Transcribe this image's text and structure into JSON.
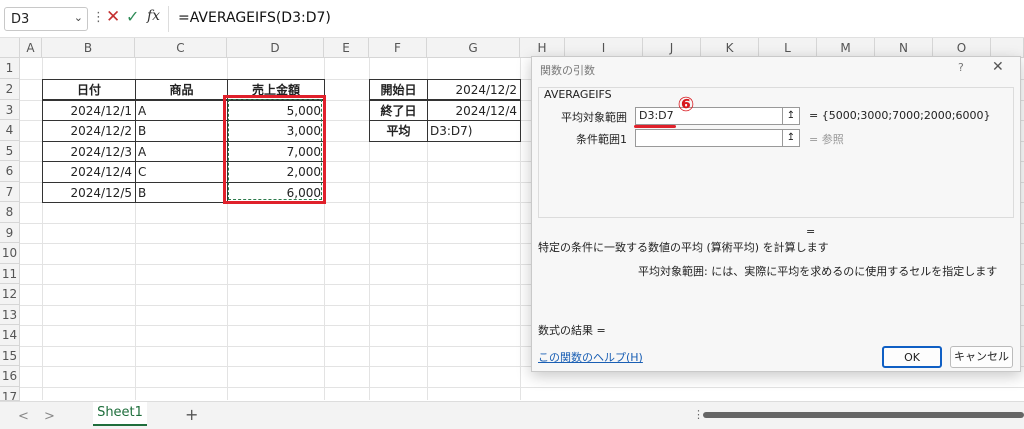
{
  "formula_bar": {
    "name_box": "D3",
    "dots": "⋮",
    "cancel_icon": "✕",
    "enter_icon": "✓",
    "fx": "fx",
    "formula": "=AVERAGEIFS(D3:D7)"
  },
  "columns": [
    "A",
    "B",
    "C",
    "D",
    "E",
    "F",
    "G",
    "H",
    "I",
    "J",
    "K",
    "L",
    "M",
    "N",
    "O"
  ],
  "rows": [
    "1",
    "2",
    "3",
    "4",
    "5",
    "6",
    "7",
    "8",
    "9",
    "10",
    "11",
    "12",
    "13",
    "14",
    "15",
    "16",
    "17"
  ],
  "table": {
    "headers": [
      "日付",
      "商品",
      "売上金額"
    ],
    "rows": [
      [
        "2024/12/1",
        "A",
        "5,000"
      ],
      [
        "2024/12/2",
        "B",
        "3,000"
      ],
      [
        "2024/12/3",
        "A",
        "7,000"
      ],
      [
        "2024/12/4",
        "C",
        "2,000"
      ],
      [
        "2024/12/5",
        "B",
        "6,000"
      ]
    ]
  },
  "criteria": {
    "start_label": "開始日",
    "start_value": "2024/12/2",
    "end_label": "終了日",
    "end_value": "2024/12/4",
    "avg_label": "平均",
    "avg_value": "D3:D7)"
  },
  "dialog": {
    "title": "関数の引数",
    "help_q": "?",
    "close": "✕",
    "function_name": "AVERAGEIFS",
    "arg1_label": "平均対象範囲",
    "arg1_value": "D3:D7",
    "arg1_result": "= {5000;3000;7000;2000;6000}",
    "arg2_label": "条件範囲1",
    "arg2_value": "",
    "arg2_result": "= 参照",
    "equals": "=",
    "description": "特定の条件に一致する数値の平均 (算術平均) を計算します",
    "arg_description": "平均対象範囲:  には、実際に平均を求めるのに使用するセルを指定します",
    "result_label": "数式の結果 =",
    "help_link": "この関数のヘルプ(H)",
    "ok": "OK",
    "cancel": "キャンセル",
    "ref_button": "↥"
  },
  "annotation": {
    "marker": "⑥"
  },
  "sheet_tabs": {
    "prev": "<",
    "next": ">",
    "active": "Sheet1",
    "add": "+",
    "sep": "⋮"
  }
}
